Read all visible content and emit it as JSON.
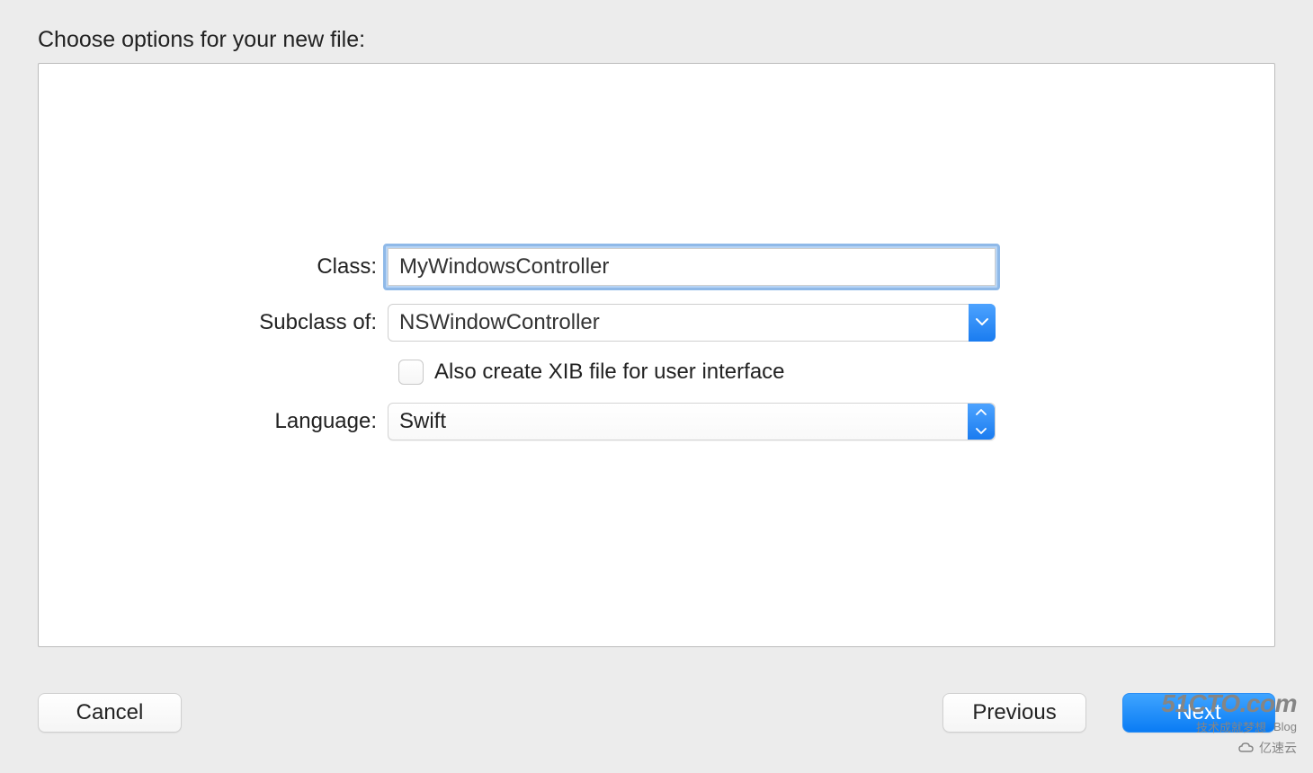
{
  "header": {
    "title": "Choose options for your new file:"
  },
  "form": {
    "class_label": "Class:",
    "class_value": "MyWindowsController",
    "subclass_label": "Subclass of:",
    "subclass_value": "NSWindowController",
    "xib_checkbox_label": "Also create XIB file for user interface",
    "language_label": "Language:",
    "language_value": "Swift"
  },
  "buttons": {
    "cancel": "Cancel",
    "previous": "Previous",
    "next": "Next"
  },
  "watermark": {
    "main": "51CTO.com",
    "sub1": "技术成就梦想",
    "sub2": "Blog",
    "cloud": "亿速云"
  }
}
